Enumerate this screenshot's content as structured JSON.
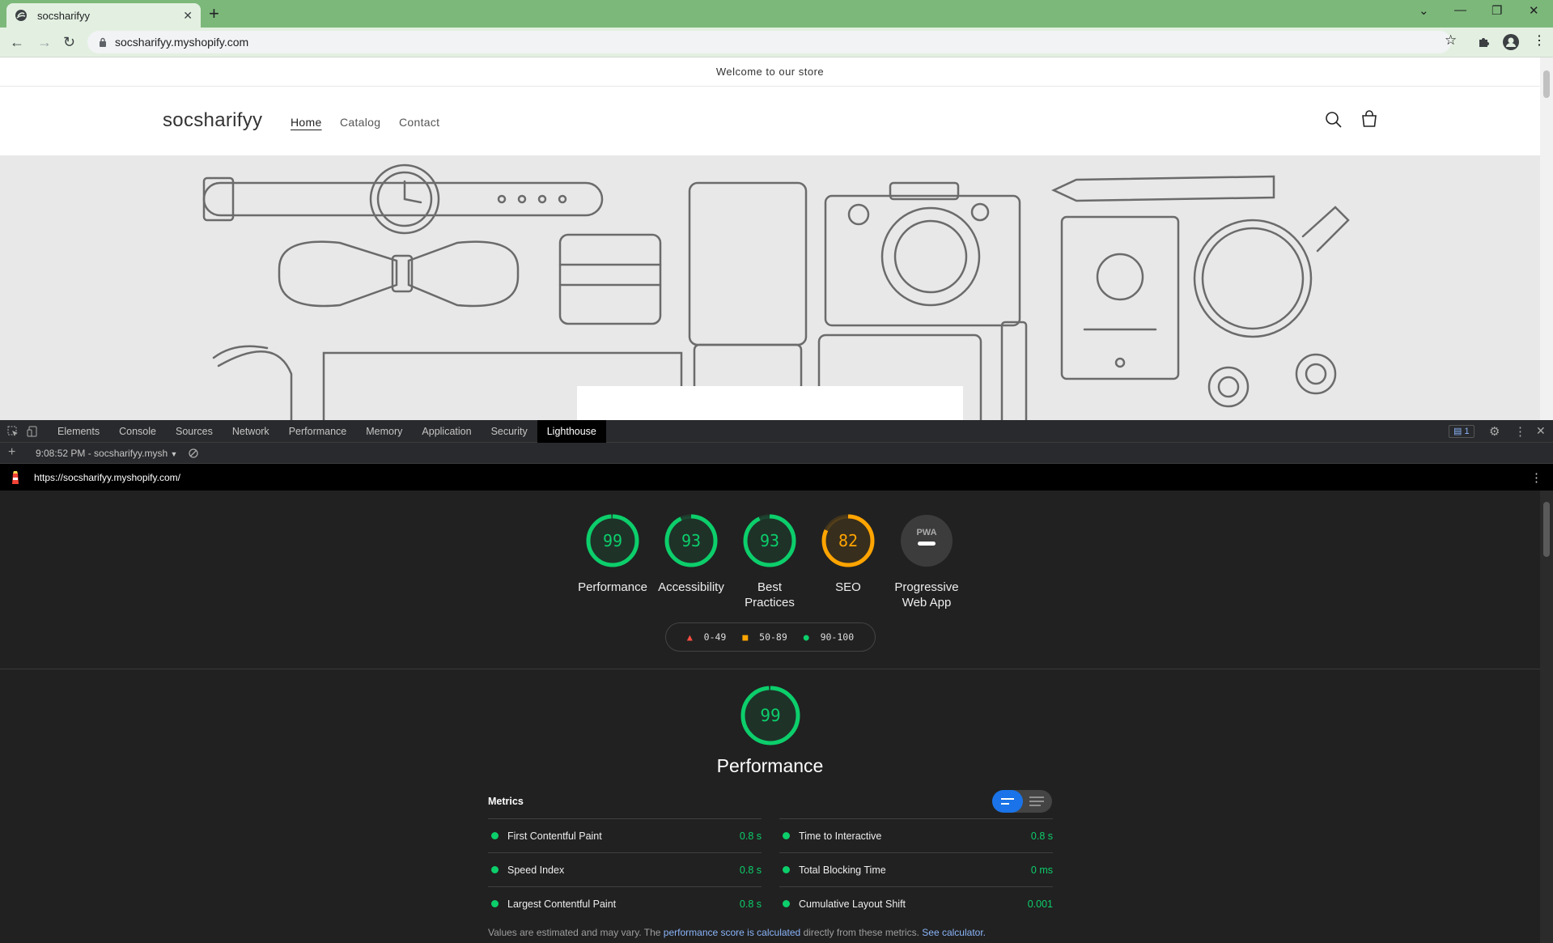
{
  "browser": {
    "tab_title": "socsharifyy",
    "address": "socsharifyy.myshopify.com"
  },
  "site": {
    "announcement": "Welcome to our store",
    "logo": "socsharifyy",
    "nav": [
      "Home",
      "Catalog",
      "Contact"
    ]
  },
  "devtools": {
    "tabs": [
      "Elements",
      "Console",
      "Sources",
      "Network",
      "Performance",
      "Memory",
      "Application",
      "Security",
      "Lighthouse"
    ],
    "active_tab": "Lighthouse",
    "issues_count": "1",
    "report_selector": "9:08:52 PM - socsharifyy.mysh",
    "report_url": "https://socsharifyy.myshopify.com/"
  },
  "lighthouse": {
    "categories": [
      {
        "label": "Performance",
        "score": "99",
        "value": 99,
        "color": "#0cce6b"
      },
      {
        "label": "Accessibility",
        "score": "93",
        "value": 93,
        "color": "#0cce6b"
      },
      {
        "label": "Best Practices",
        "score": "93",
        "value": 93,
        "color": "#0cce6b"
      },
      {
        "label": "SEO",
        "score": "82",
        "value": 82,
        "color": "#ffa400"
      },
      {
        "label": "Progressive Web App",
        "score": "PWA",
        "value": null,
        "color": "#9aa0a6"
      }
    ],
    "legend": [
      "0-49",
      "50-89",
      "90-100"
    ],
    "performance_section": {
      "score": "99",
      "value": 99,
      "title": "Performance",
      "metrics_heading": "Metrics",
      "metrics_left": [
        {
          "name": "First Contentful Paint",
          "value": "0.8 s"
        },
        {
          "name": "Speed Index",
          "value": "0.8 s"
        },
        {
          "name": "Largest Contentful Paint",
          "value": "0.8 s"
        }
      ],
      "metrics_right": [
        {
          "name": "Time to Interactive",
          "value": "0.8 s"
        },
        {
          "name": "Total Blocking Time",
          "value": "0 ms"
        },
        {
          "name": "Cumulative Layout Shift",
          "value": "0.001"
        }
      ],
      "footnote_pre": "Values are estimated and may vary. The",
      "footnote_link1": "performance score is calculated",
      "footnote_mid": "directly from these metrics.",
      "footnote_link2": "See calculator."
    }
  }
}
